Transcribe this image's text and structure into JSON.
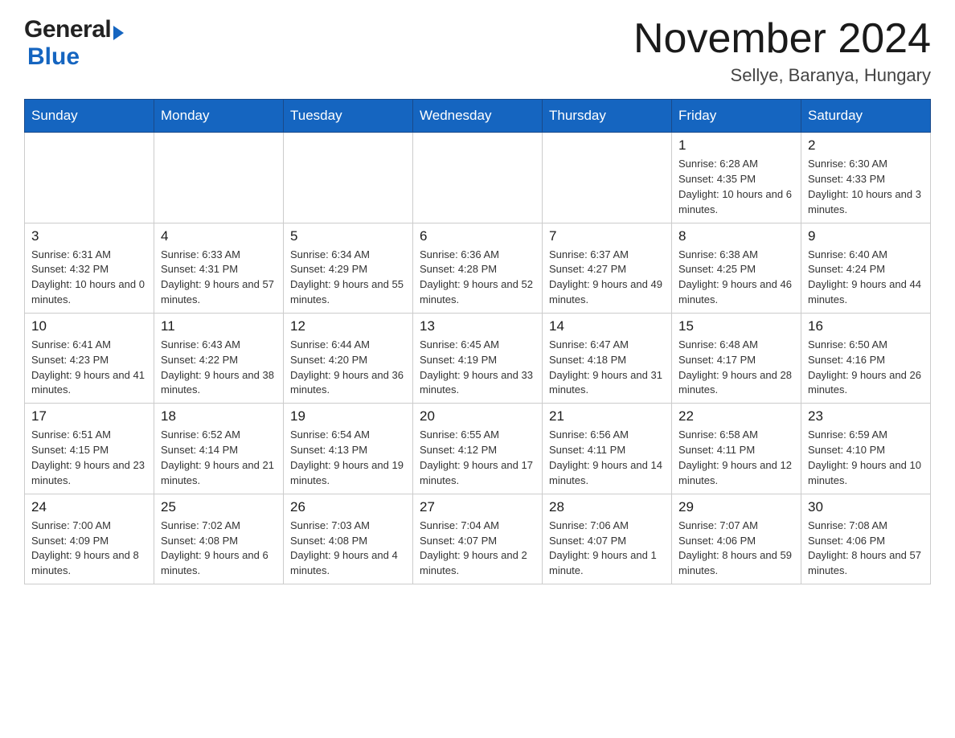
{
  "header": {
    "month_title": "November 2024",
    "location": "Sellye, Baranya, Hungary"
  },
  "logo": {
    "part1": "General",
    "part2": "Blue"
  },
  "days_of_week": [
    "Sunday",
    "Monday",
    "Tuesday",
    "Wednesday",
    "Thursday",
    "Friday",
    "Saturday"
  ],
  "weeks": [
    {
      "days": [
        {
          "number": "",
          "info": ""
        },
        {
          "number": "",
          "info": ""
        },
        {
          "number": "",
          "info": ""
        },
        {
          "number": "",
          "info": ""
        },
        {
          "number": "",
          "info": ""
        },
        {
          "number": "1",
          "info": "Sunrise: 6:28 AM\nSunset: 4:35 PM\nDaylight: 10 hours and 6 minutes."
        },
        {
          "number": "2",
          "info": "Sunrise: 6:30 AM\nSunset: 4:33 PM\nDaylight: 10 hours and 3 minutes."
        }
      ]
    },
    {
      "days": [
        {
          "number": "3",
          "info": "Sunrise: 6:31 AM\nSunset: 4:32 PM\nDaylight: 10 hours and 0 minutes."
        },
        {
          "number": "4",
          "info": "Sunrise: 6:33 AM\nSunset: 4:31 PM\nDaylight: 9 hours and 57 minutes."
        },
        {
          "number": "5",
          "info": "Sunrise: 6:34 AM\nSunset: 4:29 PM\nDaylight: 9 hours and 55 minutes."
        },
        {
          "number": "6",
          "info": "Sunrise: 6:36 AM\nSunset: 4:28 PM\nDaylight: 9 hours and 52 minutes."
        },
        {
          "number": "7",
          "info": "Sunrise: 6:37 AM\nSunset: 4:27 PM\nDaylight: 9 hours and 49 minutes."
        },
        {
          "number": "8",
          "info": "Sunrise: 6:38 AM\nSunset: 4:25 PM\nDaylight: 9 hours and 46 minutes."
        },
        {
          "number": "9",
          "info": "Sunrise: 6:40 AM\nSunset: 4:24 PM\nDaylight: 9 hours and 44 minutes."
        }
      ]
    },
    {
      "days": [
        {
          "number": "10",
          "info": "Sunrise: 6:41 AM\nSunset: 4:23 PM\nDaylight: 9 hours and 41 minutes."
        },
        {
          "number": "11",
          "info": "Sunrise: 6:43 AM\nSunset: 4:22 PM\nDaylight: 9 hours and 38 minutes."
        },
        {
          "number": "12",
          "info": "Sunrise: 6:44 AM\nSunset: 4:20 PM\nDaylight: 9 hours and 36 minutes."
        },
        {
          "number": "13",
          "info": "Sunrise: 6:45 AM\nSunset: 4:19 PM\nDaylight: 9 hours and 33 minutes."
        },
        {
          "number": "14",
          "info": "Sunrise: 6:47 AM\nSunset: 4:18 PM\nDaylight: 9 hours and 31 minutes."
        },
        {
          "number": "15",
          "info": "Sunrise: 6:48 AM\nSunset: 4:17 PM\nDaylight: 9 hours and 28 minutes."
        },
        {
          "number": "16",
          "info": "Sunrise: 6:50 AM\nSunset: 4:16 PM\nDaylight: 9 hours and 26 minutes."
        }
      ]
    },
    {
      "days": [
        {
          "number": "17",
          "info": "Sunrise: 6:51 AM\nSunset: 4:15 PM\nDaylight: 9 hours and 23 minutes."
        },
        {
          "number": "18",
          "info": "Sunrise: 6:52 AM\nSunset: 4:14 PM\nDaylight: 9 hours and 21 minutes."
        },
        {
          "number": "19",
          "info": "Sunrise: 6:54 AM\nSunset: 4:13 PM\nDaylight: 9 hours and 19 minutes."
        },
        {
          "number": "20",
          "info": "Sunrise: 6:55 AM\nSunset: 4:12 PM\nDaylight: 9 hours and 17 minutes."
        },
        {
          "number": "21",
          "info": "Sunrise: 6:56 AM\nSunset: 4:11 PM\nDaylight: 9 hours and 14 minutes."
        },
        {
          "number": "22",
          "info": "Sunrise: 6:58 AM\nSunset: 4:11 PM\nDaylight: 9 hours and 12 minutes."
        },
        {
          "number": "23",
          "info": "Sunrise: 6:59 AM\nSunset: 4:10 PM\nDaylight: 9 hours and 10 minutes."
        }
      ]
    },
    {
      "days": [
        {
          "number": "24",
          "info": "Sunrise: 7:00 AM\nSunset: 4:09 PM\nDaylight: 9 hours and 8 minutes."
        },
        {
          "number": "25",
          "info": "Sunrise: 7:02 AM\nSunset: 4:08 PM\nDaylight: 9 hours and 6 minutes."
        },
        {
          "number": "26",
          "info": "Sunrise: 7:03 AM\nSunset: 4:08 PM\nDaylight: 9 hours and 4 minutes."
        },
        {
          "number": "27",
          "info": "Sunrise: 7:04 AM\nSunset: 4:07 PM\nDaylight: 9 hours and 2 minutes."
        },
        {
          "number": "28",
          "info": "Sunrise: 7:06 AM\nSunset: 4:07 PM\nDaylight: 9 hours and 1 minute."
        },
        {
          "number": "29",
          "info": "Sunrise: 7:07 AM\nSunset: 4:06 PM\nDaylight: 8 hours and 59 minutes."
        },
        {
          "number": "30",
          "info": "Sunrise: 7:08 AM\nSunset: 4:06 PM\nDaylight: 8 hours and 57 minutes."
        }
      ]
    }
  ]
}
